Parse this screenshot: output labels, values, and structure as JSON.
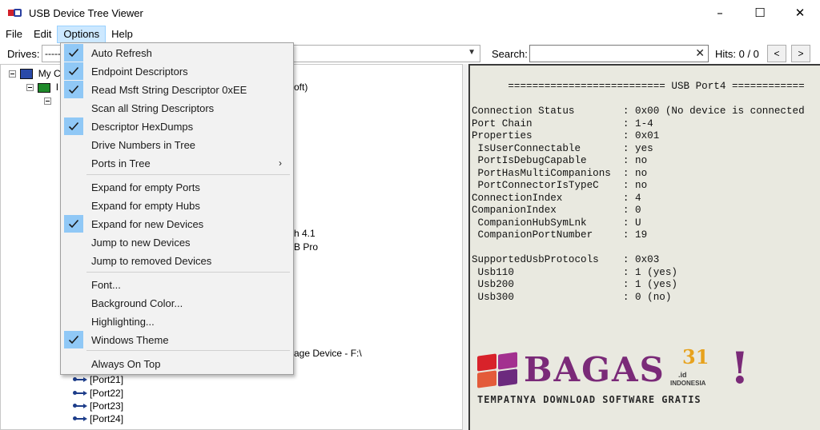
{
  "window": {
    "title": "USB Device Tree Viewer",
    "minimize": "–",
    "maximize": "☐",
    "close": "✕"
  },
  "menubar": [
    {
      "label": "File"
    },
    {
      "label": "Edit"
    },
    {
      "label": "Options"
    },
    {
      "label": "Help"
    }
  ],
  "toolbar": {
    "drives_label": "Drives:",
    "drives_value": "-----",
    "search_label": "Search:",
    "search_value": "",
    "hits": "Hits: 0 / 0",
    "prev": "<",
    "next": ">"
  },
  "tree": {
    "root_label": "My C",
    "hub_label": "I",
    "partial_text_1": "oft)",
    "partial_text_2": "h 4.1",
    "partial_text_3": "B Pro",
    "partial_text_4": "age Device - F:\\",
    "ports": [
      "[Port21]",
      "[Port22]",
      "[Port23]",
      "[Port24]"
    ]
  },
  "options_menu": {
    "items": [
      {
        "label": "Auto Refresh",
        "checked": true
      },
      {
        "label": "Endpoint Descriptors",
        "checked": true
      },
      {
        "label": "Read Msft String Descriptor 0xEE",
        "checked": true
      },
      {
        "label": "Scan all String Descriptors",
        "checked": false
      },
      {
        "label": "Descriptor HexDumps",
        "checked": true
      },
      {
        "label": "Drive Numbers in Tree",
        "checked": false
      },
      {
        "label": "Ports in Tree",
        "checked": false,
        "submenu": "›"
      },
      {
        "label": "Expand for empty Ports",
        "checked": false
      },
      {
        "label": "Expand for empty Hubs",
        "checked": false
      },
      {
        "label": "Expand for new Devices",
        "checked": true
      },
      {
        "label": "Jump to new Devices",
        "checked": false
      },
      {
        "label": "Jump to removed Devices",
        "checked": false
      },
      {
        "label": "Font...",
        "checked": false
      },
      {
        "label": "Background Color...",
        "checked": false
      },
      {
        "label": "Highlighting...",
        "checked": false
      },
      {
        "label": "Windows Theme",
        "checked": true
      },
      {
        "label": "Always On Top",
        "checked": false
      }
    ]
  },
  "details": {
    "lines": [
      "      ========================== USB Port4 ============",
      "",
      "Connection Status        : 0x00 (No device is connected",
      "Port Chain               : 1-4",
      "Properties               : 0x01",
      " IsUserConnectable       : yes",
      " PortIsDebugCapable      : no",
      " PortHasMultiCompanions  : no",
      " PortConnectorIsTypeC    : no",
      "ConnectionIndex          : 4",
      "CompanionIndex           : 0",
      " CompanionHubSymLnk      : U",
      " CompanionPortNumber     : 19",
      "",
      "SupportedUsbProtocols    : 0x03",
      " Usb110                  : 1 (yes)",
      " Usb200                  : 1 (yes)",
      " Usb300                  : 0 (no)"
    ]
  },
  "watermark": {
    "brand": "BAGAS",
    "number": "31",
    "tld": ".id",
    "country": "INDONESIA",
    "exclaim": "!",
    "tagline": "TEMPATNYA DOWNLOAD SOFTWARE GRATIS"
  },
  "colors": {
    "menu_highlight": "#cce8ff",
    "check_bg": "#90c8f6",
    "detail_bg": "#e9e9e0",
    "brand_purple": "#7a2a78"
  }
}
